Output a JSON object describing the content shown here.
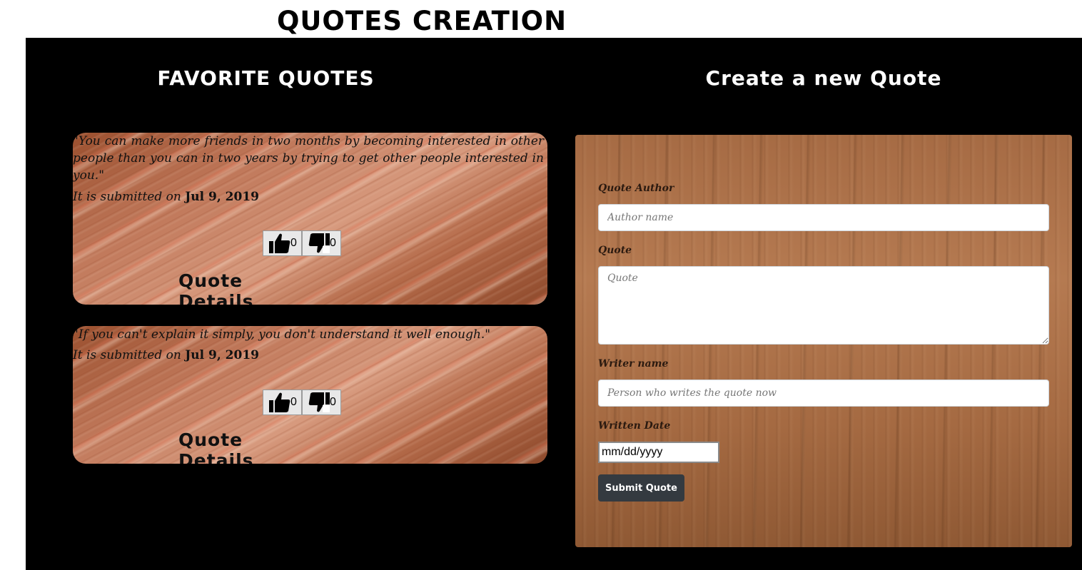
{
  "app": {
    "title": "QUOTES CREATION"
  },
  "favorites": {
    "heading": "FAVORITE QUOTES",
    "quotes": [
      {
        "text": "\"You can make more friends in two months by becoming interested in other people than you can in two years by trying to get other people interested in you.\"",
        "submitted_prefix": "It is submitted on",
        "submitted_date": "Jul 9, 2019",
        "upvotes": "0",
        "downvotes": "0",
        "details_label": "Quote Details"
      },
      {
        "text": "\"If you can't explain it simply, you don't understand it well enough.\"",
        "submitted_prefix": "It is submitted on",
        "submitted_date": "Jul 9, 2019",
        "upvotes": "0",
        "downvotes": "0",
        "details_label": "Quote Details"
      }
    ]
  },
  "form": {
    "heading": "Create a new Quote",
    "author_label": "Quote Author",
    "author_placeholder": "Author name",
    "quote_label": "Quote",
    "quote_placeholder": "Quote",
    "writer_label": "Writer name",
    "writer_placeholder": "Person who writes the quote now",
    "date_label": "Written Date",
    "date_placeholder": "mm/dd/yyyy",
    "submit_label": "Submit Quote"
  },
  "icons": {
    "upvote": "thumbs-up-icon",
    "downvote": "thumbs-down-icon"
  }
}
